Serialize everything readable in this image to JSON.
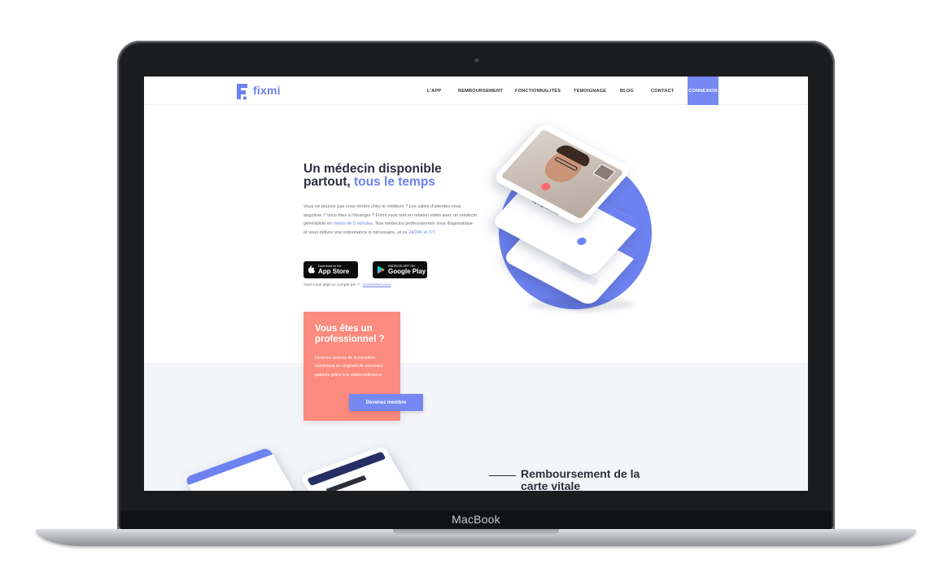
{
  "device": {
    "brand_label": "MacBook"
  },
  "nav": {
    "logo_text": "fixmi",
    "items": [
      "L'APP",
      "REMBOURSEMENT",
      "FONCTIONNALITÉS",
      "TEMOIGNAGE",
      "BLOG",
      "CONTACT"
    ],
    "cta": "CONNEXION"
  },
  "hero": {
    "title_line1": "Un médecin disponible",
    "title_line2_prefix": "partout, ",
    "title_line2_accent": "tous le temps",
    "desc_part1": "Vous ne pouvez pas vous rendre chez le médecin ? Les salles d'attentes vous angoisse ? Vous êtes à l'étranger ? Fixmi vous met en relation vidéo avec un médecin généraliste en ",
    "desc_highlight1": "moins de 5 minutes",
    "desc_part2": ". Nos médecins professionnels vous diagnostique et vous délivre une ordonnance si nécessaire, et ce ",
    "desc_highlight2": "24/24h et 7/7",
    "desc_part3": ".",
    "appstore_small": "Download on the",
    "appstore_big": "App Store",
    "googleplay_small": "ANDROID APP ON",
    "googleplay_big": "Google Play",
    "login_question": "Avez-vous déjà un compte pro ?",
    "login_link": "Connectez-vous"
  },
  "pro_card": {
    "title": "Vous êtes un professionnel ?",
    "desc": "Devenez acteurs de la transition numérique en soignant de nouveaux patients grâce à la vidéoconférence.",
    "button": "Devenez membre"
  },
  "section2": {
    "title": "Remboursement de la carte vitale"
  },
  "phone_texts": {
    "main_caption": "Avez-vous des symptomes"
  },
  "colors": {
    "accent": "#6d82f0",
    "coral": "#fb8b7e",
    "band": "#f3f5f9"
  }
}
